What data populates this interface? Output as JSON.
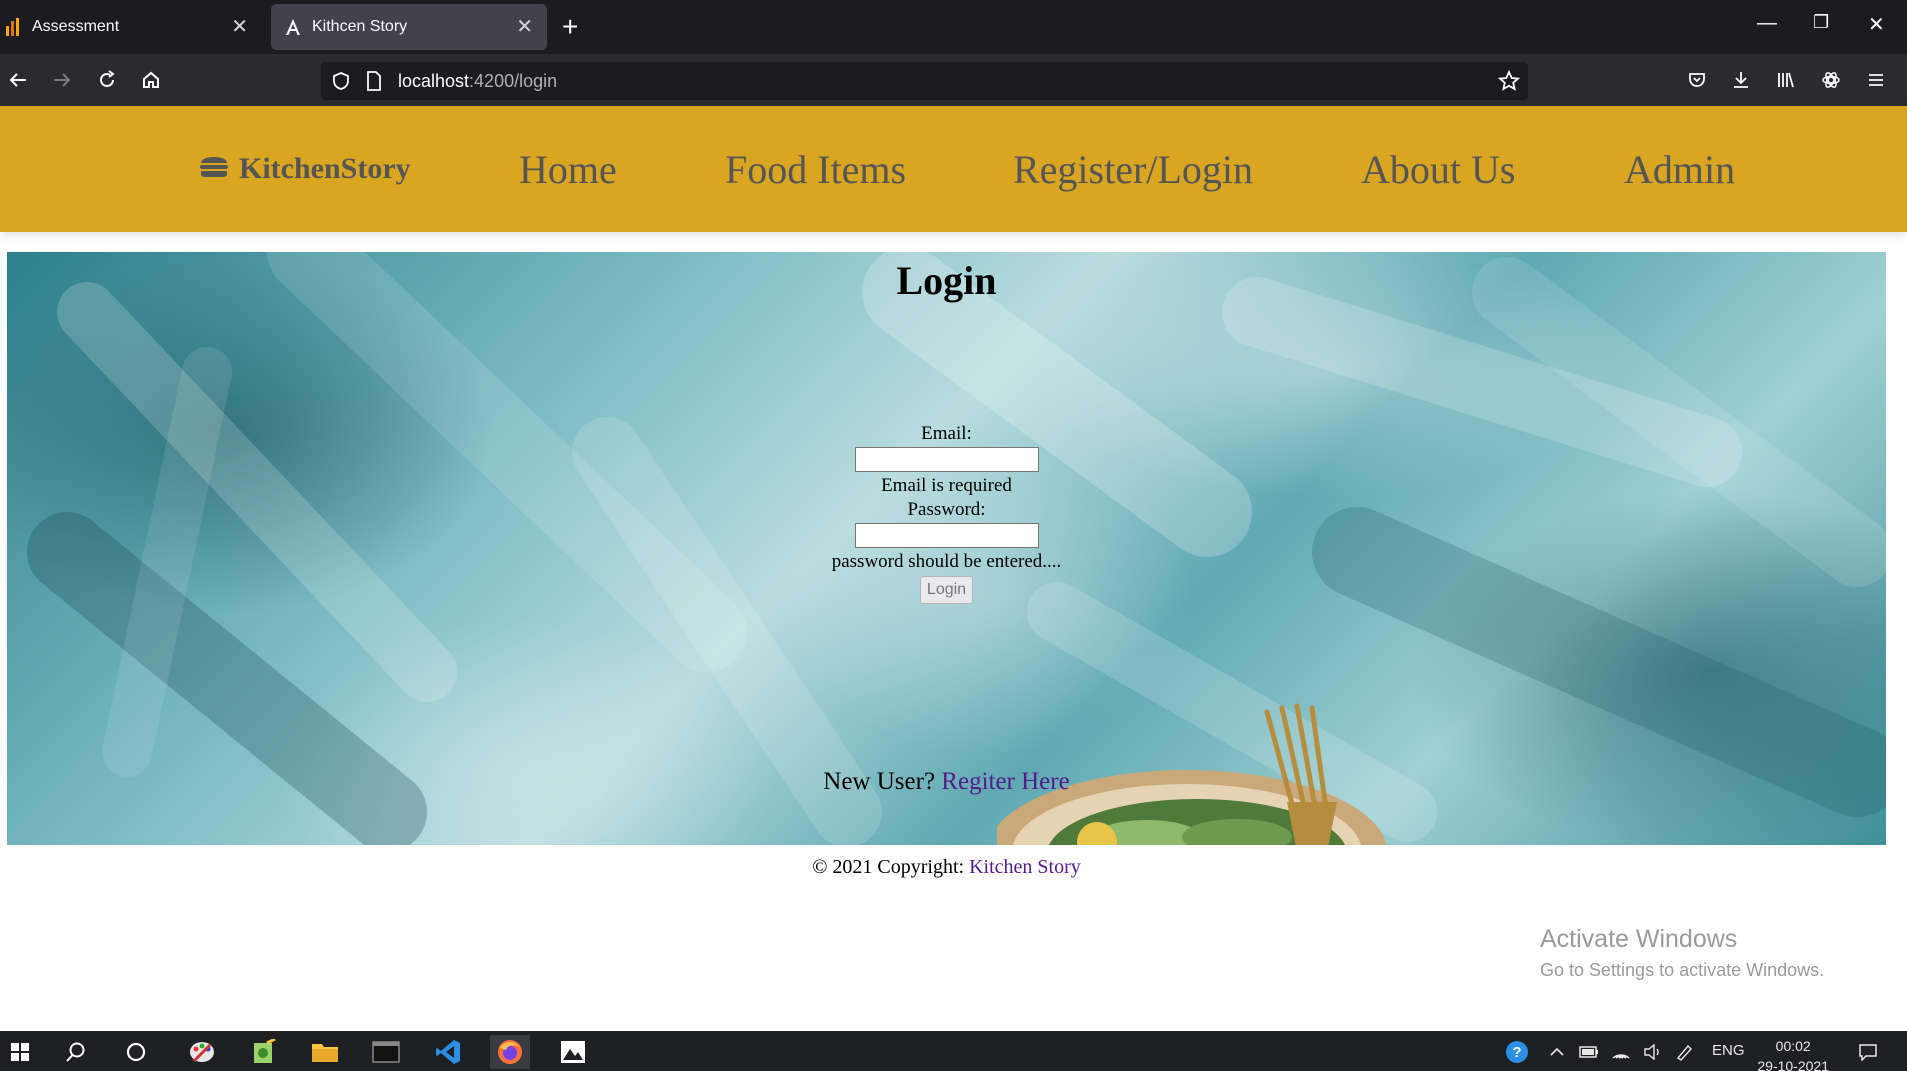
{
  "browser": {
    "tabs": [
      {
        "title": "Assessment",
        "active": false
      },
      {
        "title": "Kithcen Story",
        "active": true
      }
    ],
    "url_host": "localhost",
    "url_path": ":4200/login",
    "icons": [
      "back-icon",
      "forward-icon",
      "reload-icon",
      "home-icon",
      "shield-icon",
      "page-icon",
      "star-icon",
      "pocket-icon",
      "download-icon",
      "library-icon",
      "extension-icon",
      "menu-icon"
    ]
  },
  "site": {
    "brand": "KitchenStory",
    "nav": [
      "Home",
      "Food Items",
      "Register/Login",
      "About Us",
      "Admin"
    ],
    "accent_color": "#daa520"
  },
  "login": {
    "title": "Login",
    "email_label": "Email:",
    "email_error": "Email is required",
    "password_label": "Password:",
    "password_error": "password should be entered....",
    "button": "Login",
    "new_user_text": "New User?",
    "register_link": "Regiter Here"
  },
  "footer": {
    "text": "© 2021 Copyright:",
    "link": "Kitchen Story"
  },
  "watermark": {
    "line1": "Activate Windows",
    "line2": "Go to Settings to activate Windows."
  },
  "taskbar": {
    "lang": "ENG",
    "time": "00:02",
    "date": "29-10-2021"
  }
}
